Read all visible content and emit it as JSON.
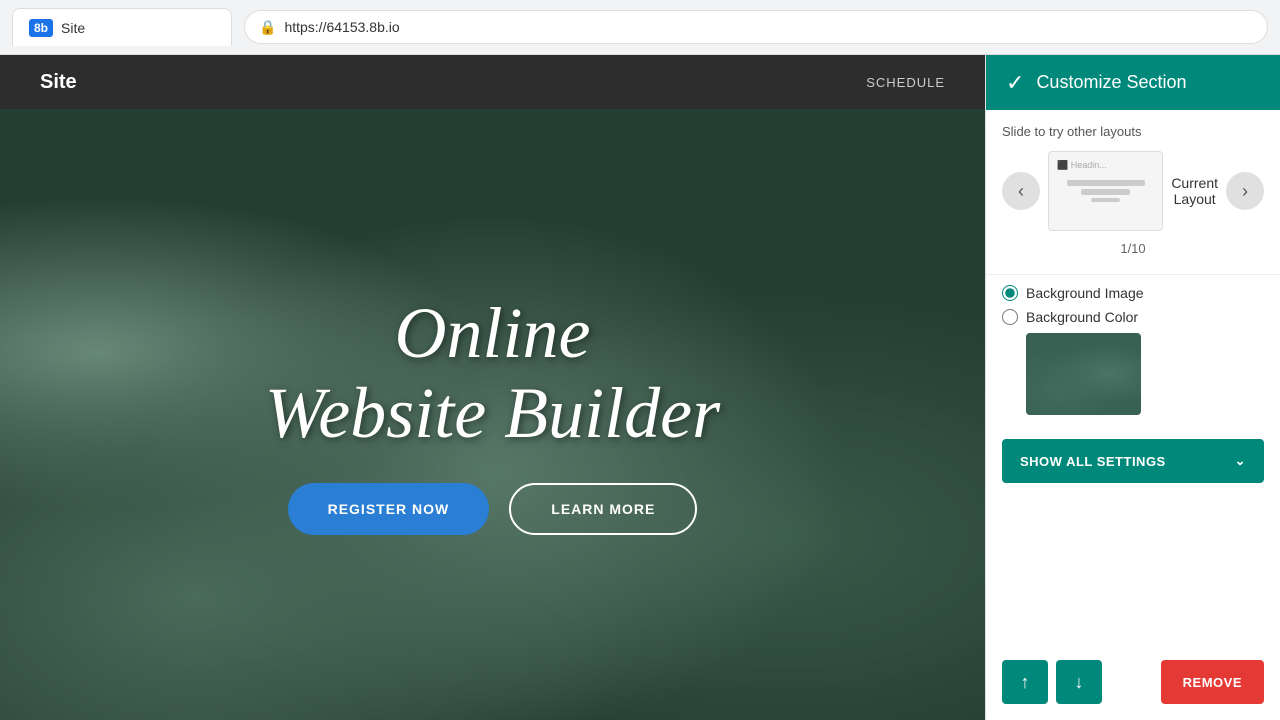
{
  "browser": {
    "tab_logo": "8b",
    "tab_title": "Site",
    "url": "https://64153.8b.io",
    "lock_icon": "🔒"
  },
  "site_nav": {
    "logo": "Site",
    "links": [
      "SCHEDULE"
    ]
  },
  "hero": {
    "title_line1": "Online",
    "title_line2": "Website Builder",
    "btn_register": "REGISTER NOW",
    "btn_learn": "LEARN MORE"
  },
  "panel": {
    "title": "Customize Section",
    "check_icon": "✓",
    "slide_label": "Slide to try other layouts",
    "prev_icon": "‹",
    "next_icon": "›",
    "current_layout_label": "Current\nLayout",
    "layout_counter": "1/10",
    "bg_image_label": "Background Image",
    "bg_color_label": "Background Color",
    "show_all_settings": "SHOW ALL SETTINGS",
    "chevron_icon": "⌄",
    "move_up_icon": "↑",
    "move_down_icon": "↓",
    "remove_label": "REMOVE"
  }
}
